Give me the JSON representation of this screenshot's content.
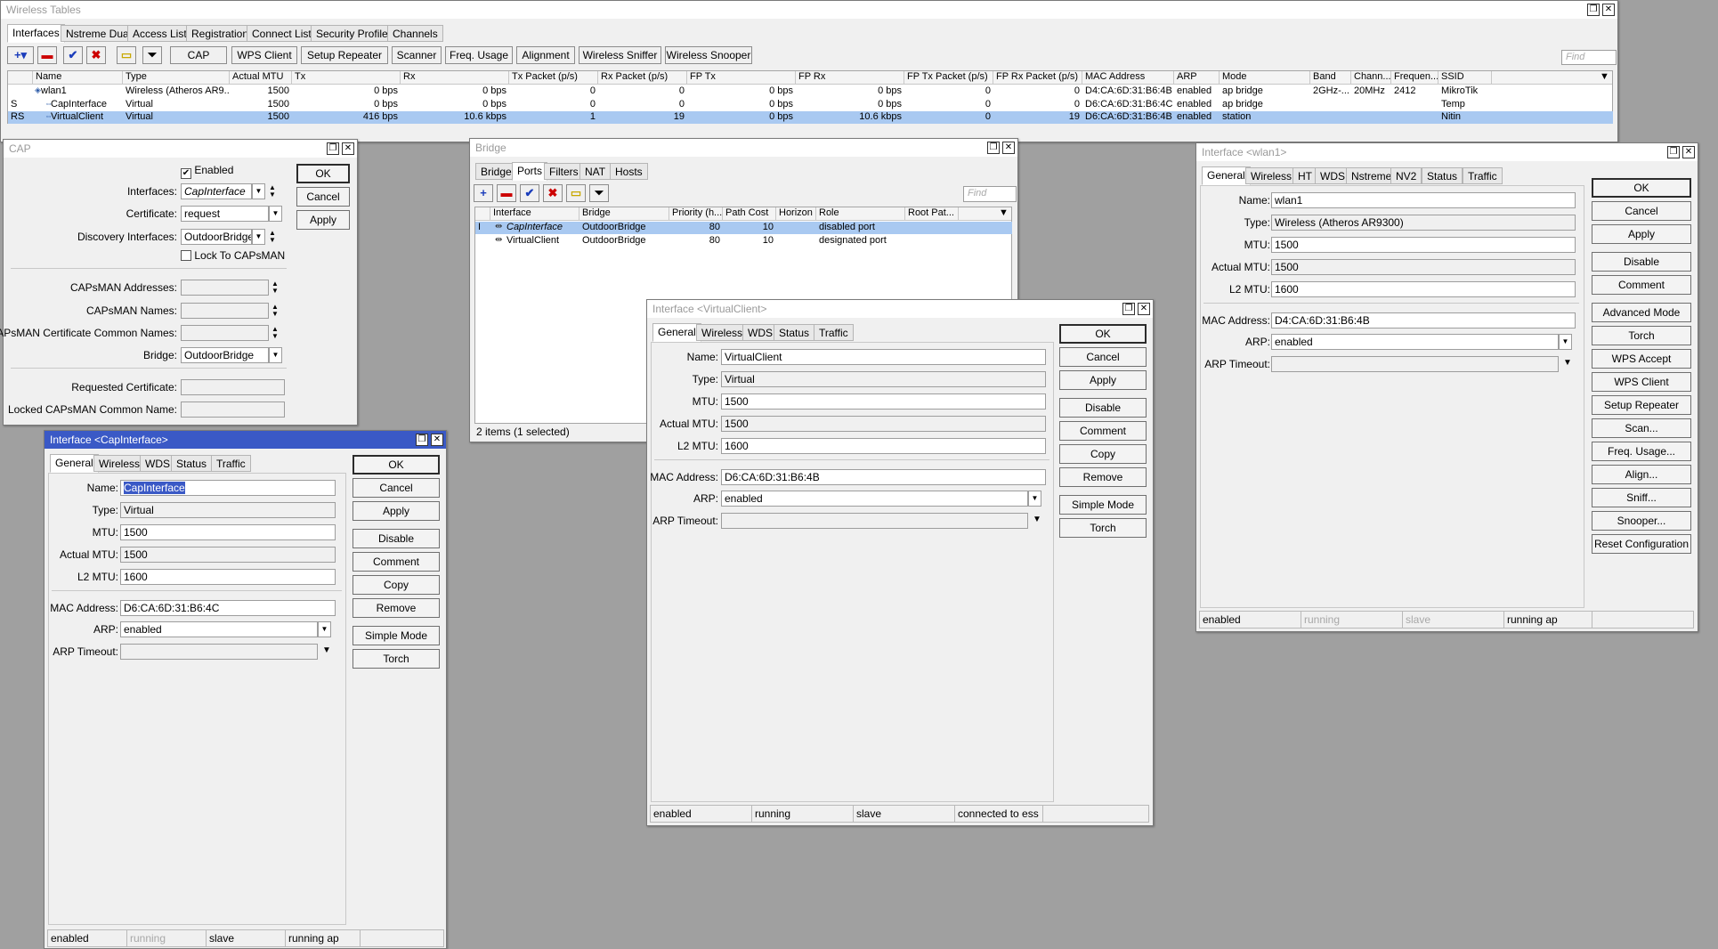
{
  "main": {
    "title": "Wireless Tables",
    "tabs": [
      "Interfaces",
      "Nstreme Dual",
      "Access List",
      "Registration",
      "Connect List",
      "Security Profiles",
      "Channels"
    ],
    "toolbar": [
      "CAP",
      "WPS Client",
      "Setup Repeater",
      "Scanner",
      "Freq. Usage",
      "Alignment",
      "Wireless Sniffer",
      "Wireless Snooper"
    ],
    "find": "Find",
    "columns": [
      "Name",
      "Type",
      "Actual MTU",
      "Tx",
      "Rx",
      "Tx Packet (p/s)",
      "Rx Packet (p/s)",
      "FP Tx",
      "FP Rx",
      "FP Tx Packet (p/s)",
      "FP Rx Packet (p/s)",
      "MAC Address",
      "ARP",
      "Mode",
      "Band",
      "Chann...",
      "Frequen...",
      "SSID"
    ],
    "rows": [
      {
        "flag": "",
        "name": "wlan1",
        "type": "Wireless (Atheros AR9...",
        "mtu": "1500",
        "tx": "0 bps",
        "rx": "0 bps",
        "txp": "0",
        "rxp": "0",
        "fptx": "0 bps",
        "fprx": "0 bps",
        "fptxp": "0",
        "fprxp": "0",
        "mac": "D4:CA:6D:31:B6:4B",
        "arp": "enabled",
        "mode": "ap bridge",
        "band": "2GHz-...",
        "chan": "20MHz",
        "freq": "2412",
        "ssid": "MikroTik"
      },
      {
        "flag": "S",
        "name": "CapInterface",
        "type": "Virtual",
        "mtu": "1500",
        "tx": "0 bps",
        "rx": "0 bps",
        "txp": "0",
        "rxp": "0",
        "fptx": "0 bps",
        "fprx": "0 bps",
        "fptxp": "0",
        "fprxp": "0",
        "mac": "D6:CA:6D:31:B6:4C",
        "arp": "enabled",
        "mode": "ap bridge",
        "band": "",
        "chan": "",
        "freq": "",
        "ssid": "Temp"
      },
      {
        "flag": "RS",
        "name": "VirtualClient",
        "type": "Virtual",
        "mtu": "1500",
        "tx": "416 bps",
        "rx": "10.6 kbps",
        "txp": "1",
        "rxp": "19",
        "fptx": "0 bps",
        "fprx": "10.6 kbps",
        "fptxp": "0",
        "fprxp": "19",
        "mac": "D6:CA:6D:31:B6:4B",
        "arp": "enabled",
        "mode": "station",
        "band": "",
        "chan": "",
        "freq": "",
        "ssid": "Nitin"
      }
    ]
  },
  "cap": {
    "title": "CAP",
    "enabled": "Enabled",
    "lbl_interfaces": "Interfaces:",
    "interfaces": "CapInterface",
    "lbl_certificate": "Certificate:",
    "certificate": "request",
    "lbl_discovery": "Discovery Interfaces:",
    "discovery": "OutdoorBridge",
    "lock": "Lock To CAPsMAN",
    "lbl_addresses": "CAPsMAN Addresses:",
    "lbl_names": "CAPsMAN Names:",
    "lbl_cert_names": "CAPsMAN Certificate Common Names:",
    "lbl_bridge": "Bridge:",
    "bridge": "OutdoorBridge",
    "lbl_req_cert": "Requested Certificate:",
    "lbl_locked": "Locked CAPsMAN Common Name:",
    "ok": "OK",
    "cancel": "Cancel",
    "apply": "Apply"
  },
  "bridge": {
    "title": "Bridge",
    "tabs": [
      "Bridge",
      "Ports",
      "Filters",
      "NAT",
      "Hosts"
    ],
    "find": "Find",
    "columns": [
      "Interface",
      "Bridge",
      "Priority (h...",
      "Path Cost",
      "Horizon",
      "Role",
      "Root Pat..."
    ],
    "rows": [
      {
        "flag": "I",
        "iface": "CapInterface",
        "bridge": "OutdoorBridge",
        "prio": "80",
        "cost": "10",
        "horizon": "",
        "role": "disabled port"
      },
      {
        "flag": "",
        "iface": "VirtualClient",
        "bridge": "OutdoorBridge",
        "prio": "80",
        "cost": "10",
        "horizon": "",
        "role": "designated port"
      }
    ],
    "status": "2 items (1 selected)"
  },
  "vc": {
    "title": "Interface <VirtualClient>",
    "tabs": [
      "General",
      "Wireless",
      "WDS",
      "Status",
      "Traffic"
    ],
    "lbl_name": "Name:",
    "name": "VirtualClient",
    "lbl_type": "Type:",
    "type": "Virtual",
    "lbl_mtu": "MTU:",
    "mtu": "1500",
    "lbl_amtu": "Actual MTU:",
    "amtu": "1500",
    "lbl_l2mtu": "L2 MTU:",
    "l2mtu": "1600",
    "lbl_mac": "MAC Address:",
    "mac": "D6:CA:6D:31:B6:4B",
    "lbl_arp": "ARP:",
    "arp": "enabled",
    "lbl_arpt": "ARP Timeout:",
    "buttons": [
      "OK",
      "Cancel",
      "Apply",
      "Disable",
      "Comment",
      "Copy",
      "Remove",
      "Simple Mode",
      "Torch"
    ],
    "status": [
      "enabled",
      "running",
      "slave",
      "connected to ess"
    ]
  },
  "ci": {
    "title": "Interface <CapInterface>",
    "tabs": [
      "General",
      "Wireless",
      "WDS",
      "Status",
      "Traffic"
    ],
    "lbl_name": "Name:",
    "name": "CapInterface",
    "lbl_type": "Type:",
    "type": "Virtual",
    "lbl_mtu": "MTU:",
    "mtu": "1500",
    "lbl_amtu": "Actual MTU:",
    "amtu": "1500",
    "lbl_l2mtu": "L2 MTU:",
    "l2mtu": "1600",
    "lbl_mac": "MAC Address:",
    "mac": "D6:CA:6D:31:B6:4C",
    "lbl_arp": "ARP:",
    "arp": "enabled",
    "lbl_arpt": "ARP Timeout:",
    "buttons": [
      "OK",
      "Cancel",
      "Apply",
      "Disable",
      "Comment",
      "Copy",
      "Remove",
      "Simple Mode",
      "Torch"
    ],
    "status": [
      "enabled",
      "running",
      "slave",
      "running ap"
    ]
  },
  "wl": {
    "title": "Interface <wlan1>",
    "tabs": [
      "General",
      "Wireless",
      "HT",
      "WDS",
      "Nstreme",
      "NV2",
      "Status",
      "Traffic"
    ],
    "lbl_name": "Name:",
    "name": "wlan1",
    "lbl_type": "Type:",
    "type": "Wireless (Atheros AR9300)",
    "lbl_mtu": "MTU:",
    "mtu": "1500",
    "lbl_amtu": "Actual MTU:",
    "amtu": "1500",
    "lbl_l2mtu": "L2 MTU:",
    "l2mtu": "1600",
    "lbl_mac": "MAC Address:",
    "mac": "D4:CA:6D:31:B6:4B",
    "lbl_arp": "ARP:",
    "arp": "enabled",
    "lbl_arpt": "ARP Timeout:",
    "buttons": [
      "OK",
      "Cancel",
      "Apply",
      "Disable",
      "Comment",
      "Advanced Mode",
      "Torch",
      "WPS Accept",
      "WPS Client",
      "Setup Repeater",
      "Scan...",
      "Freq. Usage...",
      "Align...",
      "Sniff...",
      "Snooper...",
      "Reset Configuration"
    ],
    "status": [
      "enabled",
      "running",
      "slave",
      "running ap"
    ]
  }
}
